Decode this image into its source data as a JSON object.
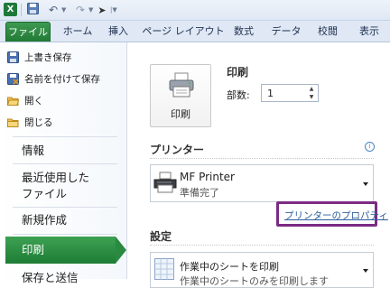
{
  "quick_access": {
    "app_icon_letter": "X",
    "icons": [
      "excel-icon",
      "save-icon",
      "undo-icon",
      "redo-icon",
      "pointer-icon"
    ]
  },
  "ribbon": {
    "tabs": [
      {
        "label": "ファイル"
      },
      {
        "label": "ホーム"
      },
      {
        "label": "挿入"
      },
      {
        "label": "ページ レイアウト"
      },
      {
        "label": "数式"
      },
      {
        "label": "データ"
      },
      {
        "label": "校閲"
      },
      {
        "label": "表示"
      }
    ],
    "file_tab_color": "#217a35"
  },
  "backstage": {
    "commands": [
      {
        "label": "上書き保存",
        "icon": "save-icon"
      },
      {
        "label": "名前を付けて保存",
        "icon": "save-as-icon"
      },
      {
        "label": "開く",
        "icon": "open-folder-icon"
      },
      {
        "label": "閉じる",
        "icon": "close-folder-icon"
      }
    ],
    "nav": {
      "info": "情報",
      "recent_line1": "最近使用した",
      "recent_line2": "ファイル",
      "new": "新規作成",
      "print": "印刷",
      "save_send": "保存と送信"
    },
    "active_color": "#2a8a40"
  },
  "print_pane": {
    "print_button_label": "印刷",
    "print_heading": "印刷",
    "copies_label": "部数:",
    "copies_value": "1",
    "printer_section_title": "プリンター",
    "printer_name": "MF Printer",
    "printer_status": "準備完了",
    "printer_properties_link": "プリンターのプロパティ",
    "settings_section_title": "設定",
    "settings_option_name": "作業中のシートを印刷",
    "settings_option_desc": "作業中のシートのみを印刷します",
    "highlight_color": "#7b2a83"
  }
}
